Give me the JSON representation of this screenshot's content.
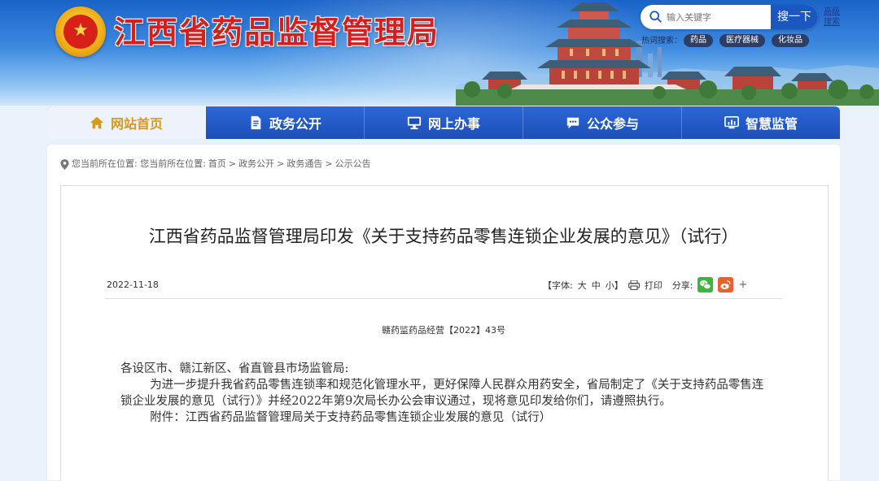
{
  "header": {
    "site_title": "江西省药品监督管理局",
    "search_placeholder": "输入关键字",
    "search_button": "搜一下",
    "advanced_search": "高级搜索",
    "hot_label": "热词搜索：",
    "hot_tags": [
      "药品",
      "医疗器械",
      "化妆品"
    ]
  },
  "nav": {
    "items": [
      {
        "label": "网站首页",
        "icon": "home-icon"
      },
      {
        "label": "政务公开",
        "icon": "document-icon"
      },
      {
        "label": "网上办事",
        "icon": "monitor-icon"
      },
      {
        "label": "公众参与",
        "icon": "chat-icon"
      },
      {
        "label": "智慧监管",
        "icon": "dashboard-icon"
      }
    ]
  },
  "breadcrumb": {
    "prefix": "您当前所在位置: 您当前所在位置:",
    "items": [
      "首页",
      "政务公开",
      "政务通告",
      "公示公告"
    ]
  },
  "article": {
    "title": "江西省药品监督管理局印发《关于支持药品零售连锁企业发展的意见》（试行）",
    "date": "2022-11-18",
    "font_label": "【字体:",
    "font_large": "大",
    "font_medium": "中",
    "font_small": "小】",
    "print_label": "打印",
    "share_label": "分享:",
    "share_more": "+",
    "doc_number": "赣药监药品经营【2022】43号",
    "greeting": "各设区市、赣江新区、省直管县市场监管局:",
    "paragraph": "为进一步提升我省药品零售连锁率和规范化管理水平，更好保障人民群众用药安全，省局制定了《关于支持药品零售连锁企业发展的意见（试行）》并经2022年第9次局长办公会审议通过，现将意见印发给你们，请遵照执行。",
    "attachment": "附件：江西省药品监督管理局关于支持药品零售连锁企业发展的意见（试行）"
  },
  "colors": {
    "nav_blue": "#1b4eb8",
    "title_red": "#d51f1f",
    "wechat_green": "#3bb53b",
    "weibo_orange": "#e8622f"
  }
}
